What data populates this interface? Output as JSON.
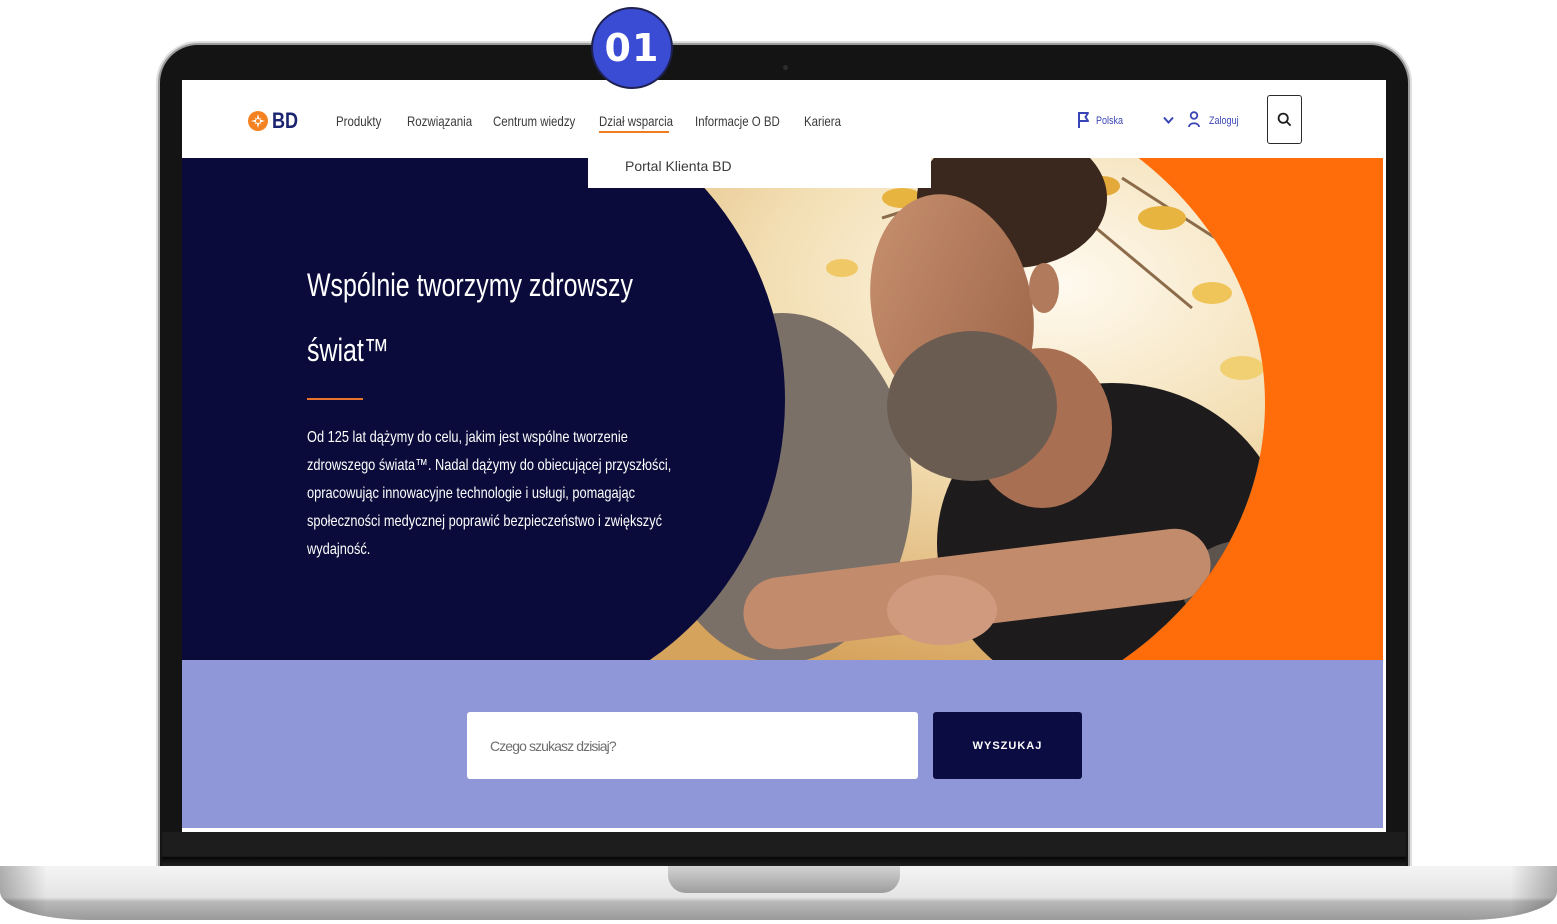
{
  "badge": {
    "label": "01"
  },
  "site": {
    "logo": {
      "text": "BD",
      "icon": "bd-logo-icon"
    },
    "nav": [
      {
        "label": "Produkty"
      },
      {
        "label": "Rozwiązania"
      },
      {
        "label": "Centrum wiedzy"
      },
      {
        "label": "Dział wsparcia",
        "active": true
      },
      {
        "label": "Informacje O BD"
      },
      {
        "label": "Kariera"
      }
    ],
    "dropdown": {
      "items": [
        {
          "label": "Portal Klienta BD"
        }
      ]
    },
    "region": {
      "label": "Polska",
      "icon": "flag-icon",
      "toggle_icon": "chevron-down-icon"
    },
    "login": {
      "label": "Zaloguj",
      "icon": "user-icon"
    },
    "search_button": {
      "icon": "search-icon"
    }
  },
  "hero": {
    "title": [
      "Wspólnie tworzymy zdrowszy",
      "świat™"
    ],
    "body_lines": [
      "Od 125 lat dążymy do celu, jakim jest wspólne tworzenie",
      "zdrowszego świata™. Nadal dążymy do obiecującej przyszłości,",
      "opracowując innowacyjne technologie i usługi, pomagając",
      "społeczności medycznej poprawić bezpieczeństwo i zwiększyć",
      "wydajność."
    ]
  },
  "search": {
    "placeholder": "Czego szukasz dzisiaj?",
    "button_label": "WYSZUKAJ"
  },
  "colors": {
    "badge_blue": "#3a4bd4",
    "brand_navy": "#1a2470",
    "hero_navy": "#0a0b3a",
    "accent_orange": "#ff6c0a",
    "active_underline": "#f07d22",
    "search_band": "#8f97d9",
    "button_navy": "#0b0c42",
    "utility_blue": "#3a45b5"
  }
}
